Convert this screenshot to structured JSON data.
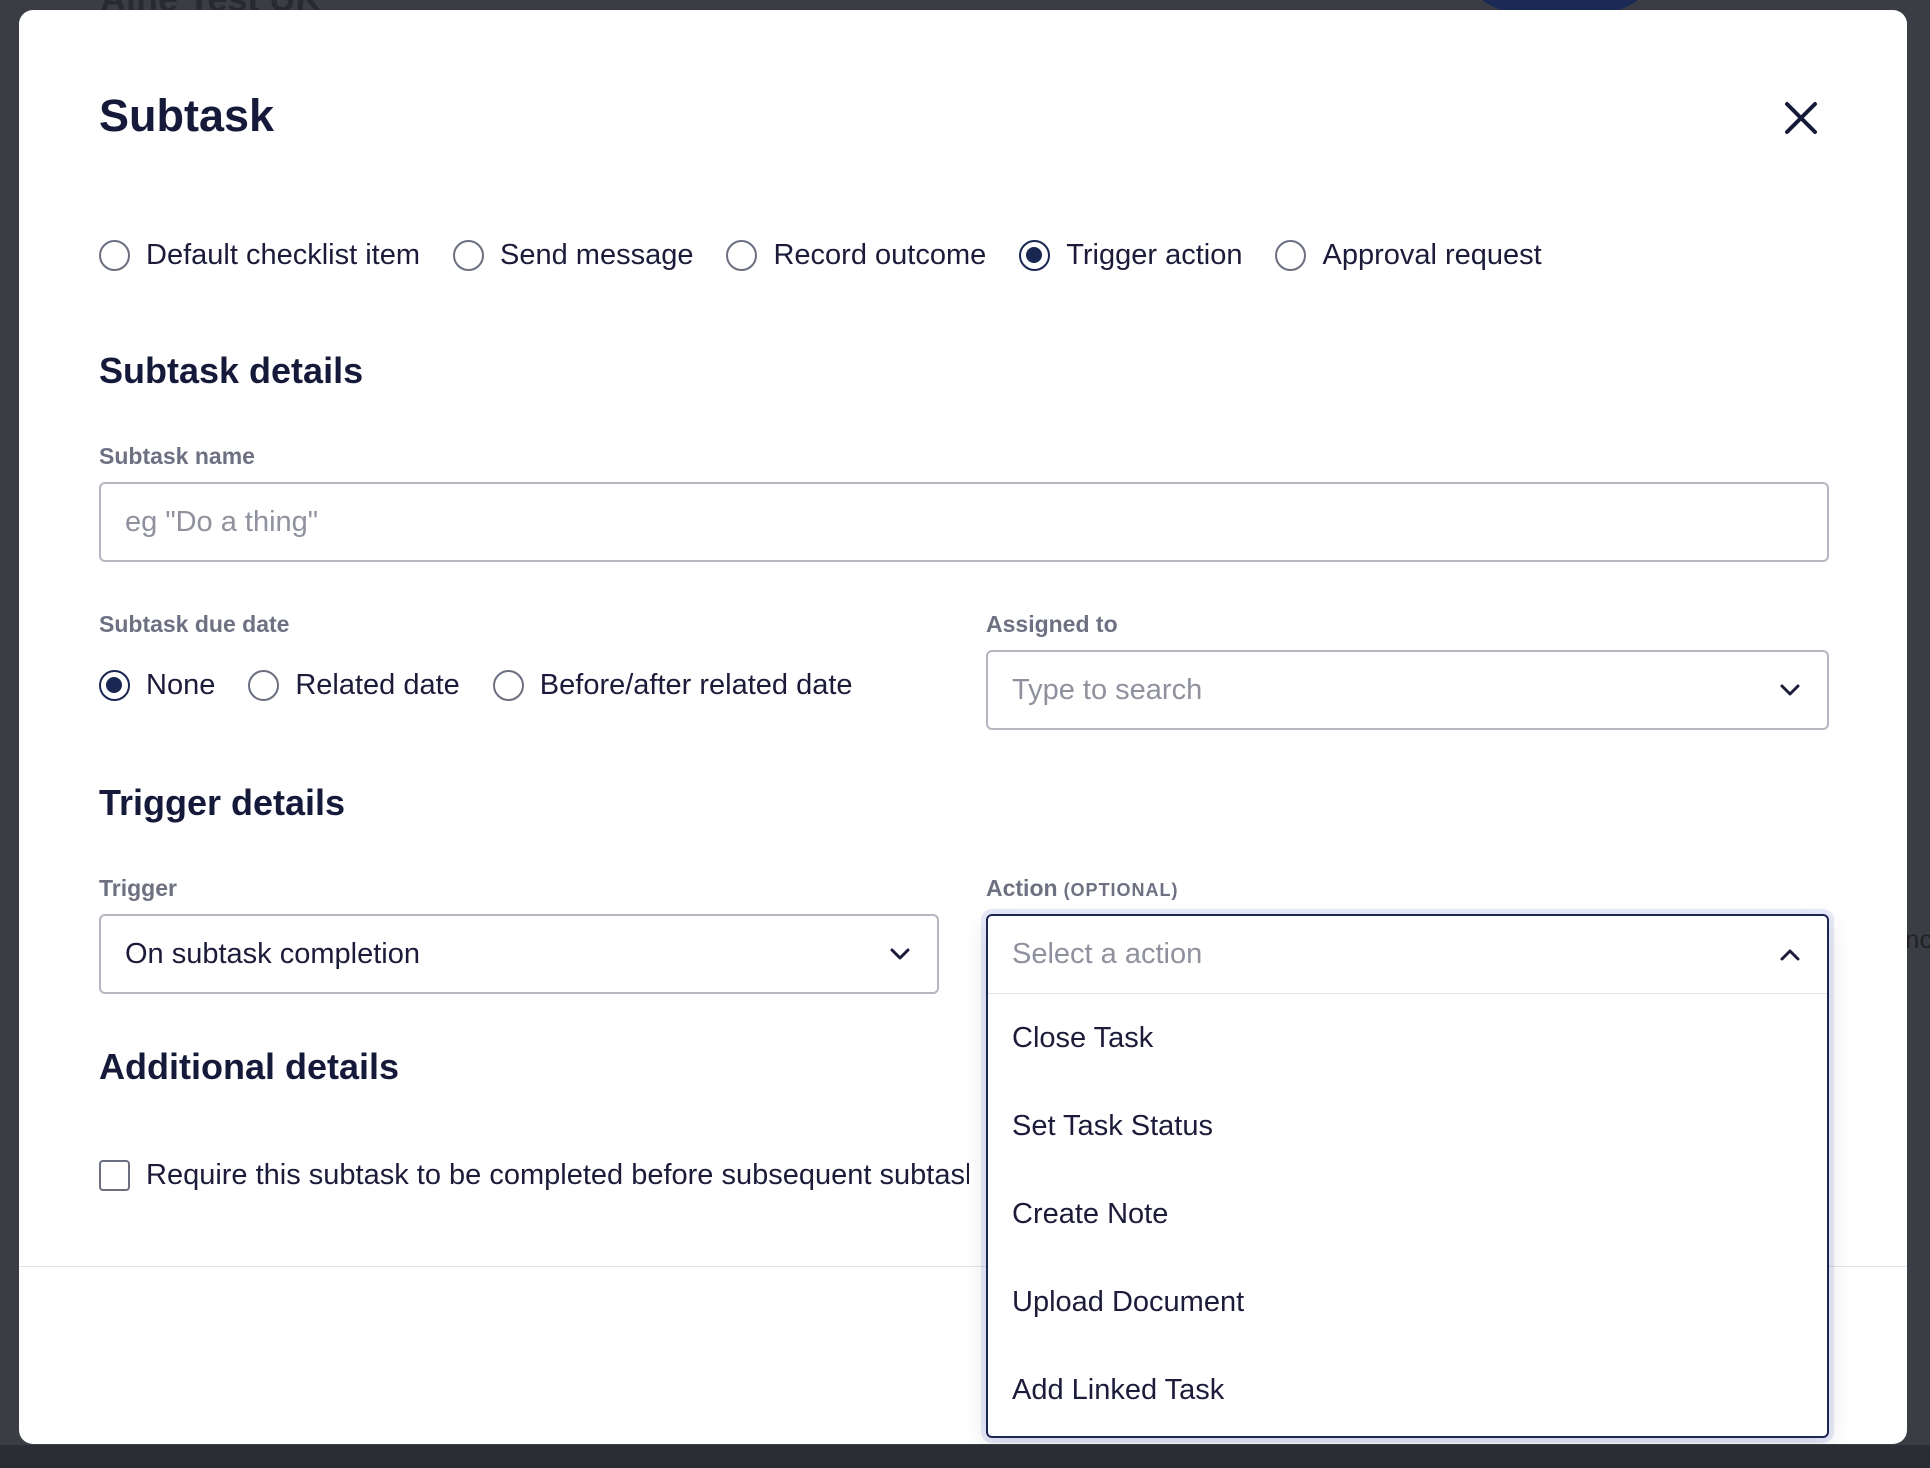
{
  "background": {
    "title": "Aine Test UK",
    "side_text": "nc"
  },
  "modal": {
    "title": "Subtask",
    "close_icon": "close-icon",
    "subtask_types": [
      {
        "label": "Default checklist item",
        "checked": false
      },
      {
        "label": "Send message",
        "checked": false
      },
      {
        "label": "Record outcome",
        "checked": false
      },
      {
        "label": "Trigger action",
        "checked": true
      },
      {
        "label": "Approval request",
        "checked": false
      }
    ]
  },
  "subtask_details": {
    "heading": "Subtask details",
    "name_label": "Subtask name",
    "name_placeholder": "eg \"Do a thing\"",
    "due_date_label": "Subtask due date",
    "due_date_options": [
      {
        "label": "None",
        "checked": true
      },
      {
        "label": "Related date",
        "checked": false
      },
      {
        "label": "Before/after related date",
        "checked": false
      }
    ],
    "assigned_label": "Assigned to",
    "assigned_placeholder": "Type to search"
  },
  "trigger_details": {
    "heading": "Trigger details",
    "trigger_label": "Trigger",
    "trigger_value": "On subtask completion",
    "action_label": "Action",
    "action_optional": "(OPTIONAL)",
    "action_placeholder": "Select a action",
    "action_options": [
      "Close Task",
      "Set Task Status",
      "Create Note",
      "Upload Document",
      "Add Linked Task"
    ]
  },
  "additional_details": {
    "heading": "Additional details",
    "require_label": "Require this subtask to be completed before subsequent subtasks"
  },
  "colors": {
    "primary": "#1a2752",
    "text": "#1c1c3a",
    "muted": "#6e7182",
    "placeholder": "#8f929e"
  }
}
